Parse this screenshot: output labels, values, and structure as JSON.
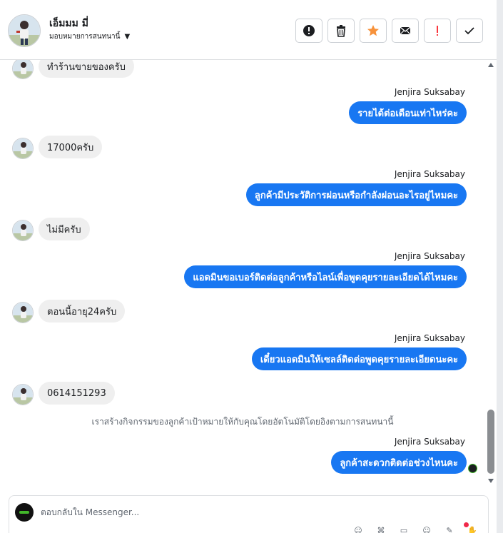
{
  "header": {
    "name": "เอ็มมม มี่",
    "assign_label": "มอบหมายการสนทนานี้"
  },
  "toolbar": {
    "buttons": [
      {
        "icon": "alert-circle-icon",
        "color": "#1c1e21"
      },
      {
        "icon": "trash-icon",
        "color": "#1c1e21"
      },
      {
        "icon": "star-icon",
        "color": "#f7923b"
      },
      {
        "icon": "envelope-icon",
        "color": "#1c1e21"
      },
      {
        "icon": "exclamation-icon",
        "color": "#fa383e"
      },
      {
        "icon": "check-icon",
        "color": "#1c1e21"
      }
    ]
  },
  "messages": [
    {
      "type": "in",
      "text": "ทำร้านขายของครับ"
    },
    {
      "type": "out",
      "sender": "Jenjira Suksabay",
      "text": "รายได้ต่อเดือนเท่าไหร่คะ"
    },
    {
      "type": "in",
      "text": "17000ครับ"
    },
    {
      "type": "out",
      "sender": "Jenjira Suksabay",
      "text": "ลูกค้ามีประวัติการผ่อนหรือกำลังผ่อนอะไรอยู่ไหมคะ"
    },
    {
      "type": "in",
      "text": "ไม่มีครับ"
    },
    {
      "type": "out",
      "sender": "Jenjira Suksabay",
      "text": "แอดมินขอเบอร์ติดต่อลูกค้าหรือไลน์เพื่อพูดคุยรายละเอียดได้ไหมคะ"
    },
    {
      "type": "in",
      "text": "ตอนนี้อายุ24ครับ"
    },
    {
      "type": "out",
      "sender": "Jenjira Suksabay",
      "text": "เดี๋ยวแอดมินให้เซลล์ติดต่อพูดคุยรายละเอียดนะคะ"
    },
    {
      "type": "in",
      "text": "0614151293"
    },
    {
      "type": "system",
      "text": "เราสร้างกิจกรรมของลูกค้าเป้าหมายให้กับคุณโดยอัตโนมัติโดยอิงตามการสนทนานี้"
    },
    {
      "type": "out",
      "sender": "Jenjira Suksabay",
      "text": "ลูกค้าสะดวกติดต่อช่วงไหนคะ"
    }
  ],
  "composer": {
    "placeholder": "ตอบกลับใน Messenger..."
  },
  "colors": {
    "outgoing_bubble": "#1877f2",
    "incoming_bubble": "#efefef",
    "accent_star": "#f7923b",
    "alert_red": "#fa383e"
  }
}
